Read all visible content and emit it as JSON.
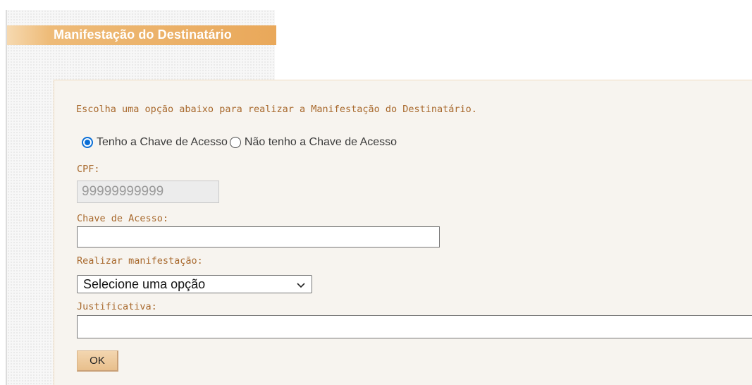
{
  "header": {
    "title": "Manifestação do Destinatário"
  },
  "form": {
    "instruction": "Escolha uma opção abaixo para realizar a Manifestação do Destinatário.",
    "radio_options": [
      {
        "label": "Tenho a Chave de Acesso",
        "checked": true
      },
      {
        "label": "Não tenho a Chave de Acesso",
        "checked": false
      }
    ],
    "cpf": {
      "label": "CPF:",
      "value": "99999999999"
    },
    "chave_acesso": {
      "label": "Chave de Acesso:",
      "value": ""
    },
    "manifestacao": {
      "label": "Realizar manifestação:",
      "selected": "Selecione uma opção"
    },
    "justificativa": {
      "label": "Justificativa:",
      "value": ""
    },
    "ok_label": "OK"
  },
  "colors": {
    "label_brown": "#a8692d",
    "title_bar": "#e9a85a",
    "radio_blue": "#0a6ed6",
    "content_bg": "#f7f4ef"
  },
  "icons": {
    "select_indicator": "chevron-down-icon"
  }
}
